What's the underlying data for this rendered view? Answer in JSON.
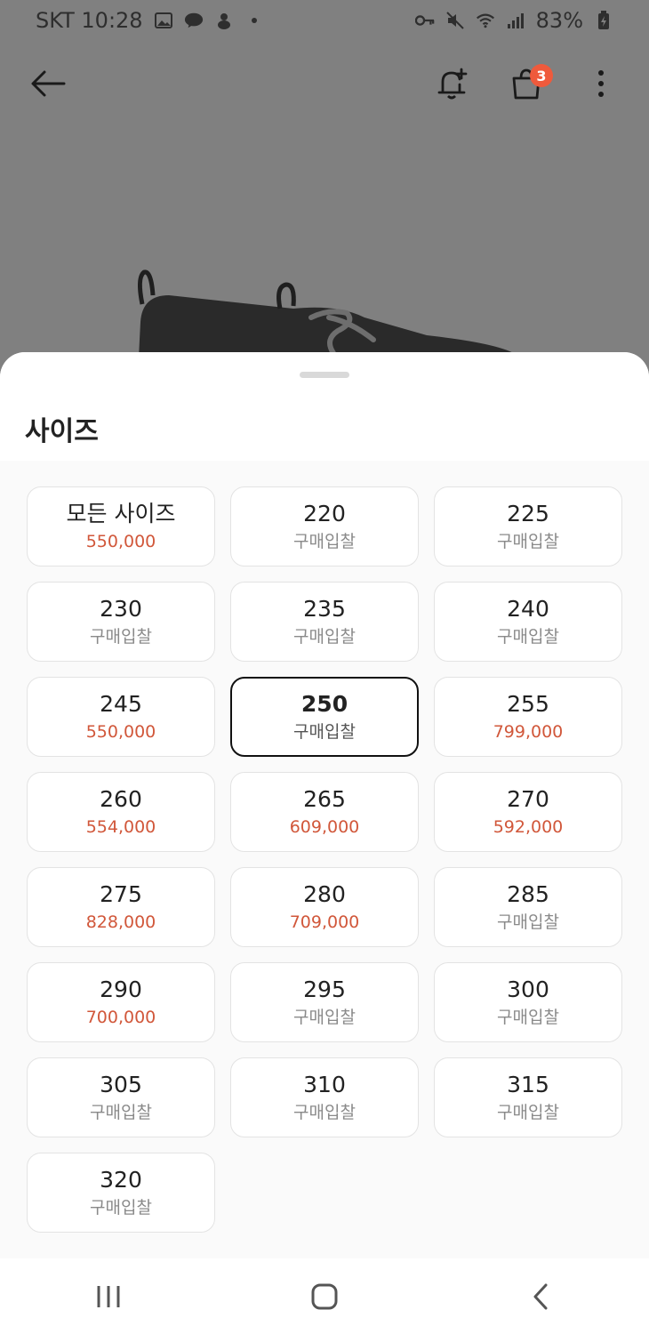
{
  "status_bar": {
    "carrier_time": "SKT 10:28",
    "battery": "83%"
  },
  "app_bar": {
    "cart_badge": "3"
  },
  "sheet": {
    "title": "사이즈",
    "sizes": [
      {
        "label": "모든 사이즈",
        "sub": "550,000",
        "is_price": true,
        "selected": false
      },
      {
        "label": "220",
        "sub": "구매입찰",
        "is_price": false,
        "selected": false
      },
      {
        "label": "225",
        "sub": "구매입찰",
        "is_price": false,
        "selected": false
      },
      {
        "label": "230",
        "sub": "구매입찰",
        "is_price": false,
        "selected": false
      },
      {
        "label": "235",
        "sub": "구매입찰",
        "is_price": false,
        "selected": false
      },
      {
        "label": "240",
        "sub": "구매입찰",
        "is_price": false,
        "selected": false
      },
      {
        "label": "245",
        "sub": "550,000",
        "is_price": true,
        "selected": false
      },
      {
        "label": "250",
        "sub": "구매입찰",
        "is_price": false,
        "selected": true
      },
      {
        "label": "255",
        "sub": "799,000",
        "is_price": true,
        "selected": false
      },
      {
        "label": "260",
        "sub": "554,000",
        "is_price": true,
        "selected": false
      },
      {
        "label": "265",
        "sub": "609,000",
        "is_price": true,
        "selected": false
      },
      {
        "label": "270",
        "sub": "592,000",
        "is_price": true,
        "selected": false
      },
      {
        "label": "275",
        "sub": "828,000",
        "is_price": true,
        "selected": false
      },
      {
        "label": "280",
        "sub": "709,000",
        "is_price": true,
        "selected": false
      },
      {
        "label": "285",
        "sub": "구매입찰",
        "is_price": false,
        "selected": false
      },
      {
        "label": "290",
        "sub": "700,000",
        "is_price": true,
        "selected": false
      },
      {
        "label": "295",
        "sub": "구매입찰",
        "is_price": false,
        "selected": false
      },
      {
        "label": "300",
        "sub": "구매입찰",
        "is_price": false,
        "selected": false
      },
      {
        "label": "305",
        "sub": "구매입찰",
        "is_price": false,
        "selected": false
      },
      {
        "label": "310",
        "sub": "구매입찰",
        "is_price": false,
        "selected": false
      },
      {
        "label": "315",
        "sub": "구매입찰",
        "is_price": false,
        "selected": false
      },
      {
        "label": "320",
        "sub": "구매입찰",
        "is_price": false,
        "selected": false
      }
    ]
  },
  "colors": {
    "price": "#d1573a",
    "badge": "#ef5a3c",
    "selected_border": "#111111"
  }
}
